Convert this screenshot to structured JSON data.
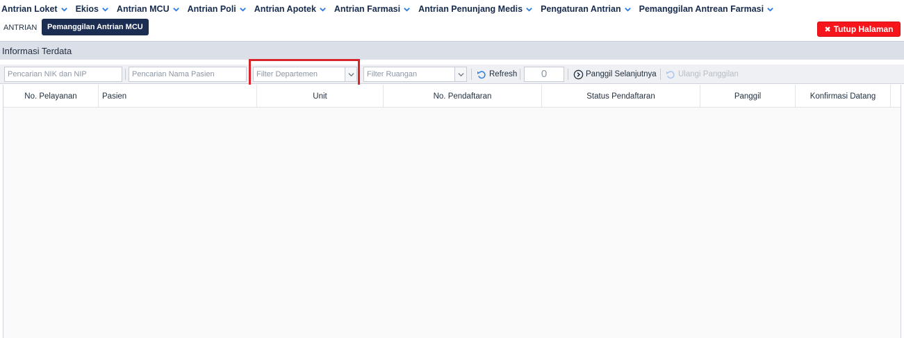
{
  "nav": {
    "items": [
      {
        "label": "Antrian Loket"
      },
      {
        "label": "Ekios"
      },
      {
        "label": "Antrian MCU"
      },
      {
        "label": "Antrian Poli"
      },
      {
        "label": "Antrian Apotek"
      },
      {
        "label": "Antrian Farmasi"
      },
      {
        "label": "Antrian Penunjang Medis"
      },
      {
        "label": "Pengaturan Antrian"
      },
      {
        "label": "Pemanggilan Antrean Farmasi"
      }
    ]
  },
  "subbar": {
    "breadcrumb": "ANTRIAN",
    "active_tab": "Pemanggilan Antrian MCU",
    "close_label": "Tutup Halaman"
  },
  "panel": {
    "title": "Informasi Terdata"
  },
  "toolbar": {
    "search_nik_placeholder": "Pencarian NIK dan NIP",
    "search_name_placeholder": "Pencarian Nama Pasien",
    "filter_department": "Filter Departemen",
    "filter_room": "Filter Ruangan",
    "refresh_label": "Refresh",
    "counter_value": "0",
    "call_next_label": "Panggil Selanjutnya",
    "recall_label": "Ulangi Panggilan"
  },
  "grid": {
    "columns": [
      "No. Pelayanan",
      "Pasien",
      "Unit",
      "No. Pendaftaran",
      "Status Pendaftaran",
      "Panggil",
      "Konfirmasi Datang"
    ]
  },
  "colors": {
    "nav_text": "#172b4d",
    "active_tab_bg": "#1b2e52",
    "close_button_bg": "#f5151b",
    "highlight_border": "#d6262b",
    "accent_icon": "#2f7de1"
  }
}
